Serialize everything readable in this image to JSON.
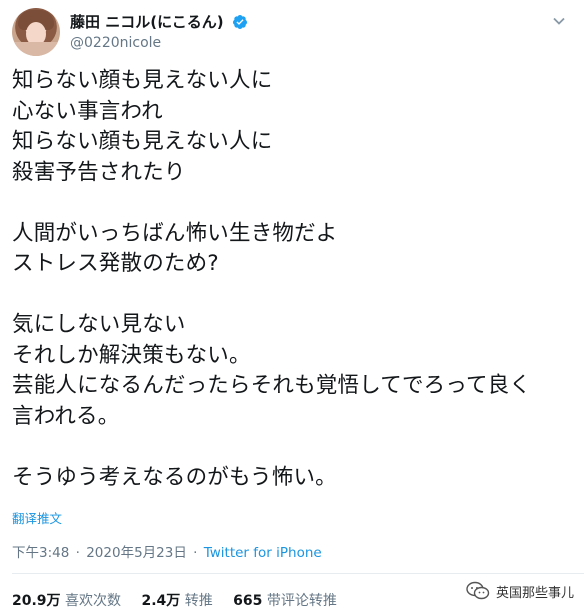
{
  "user": {
    "display_name": "藤田 ニコル(にこるん)",
    "handle": "@0220nicole"
  },
  "tweet": {
    "lines": [
      "知らない顔も見えない人に",
      "心ない事言われ",
      "知らない顔も見えない人に",
      "殺害予告されたり",
      "",
      "人間がいっちばん怖い生き物だよ",
      "ストレス発散のため?",
      "",
      "気にしない見ない",
      "それしか解決策もない。",
      "芸能人になるんだったらそれも覚悟してでろって良く",
      "言われる。",
      "",
      "そうゆう考えなるのがもう怖い。"
    ],
    "translate_label": "翻译推文"
  },
  "meta": {
    "time": "下午3:48",
    "date": "2020年5月23日",
    "separator": "·",
    "source": "Twitter for iPhone"
  },
  "stats": {
    "retweets_num": "20.9万",
    "retweets_label": "喜欢次数",
    "likes_num": "2.4万",
    "likes_label": "转推",
    "quotes_num": "665",
    "quotes_label": "带评论转推"
  },
  "watermark": {
    "text": "英国那些事儿",
    "icon": "wechat-icon"
  },
  "colors": {
    "accent": "#1b95e0",
    "secondary_text": "#657786",
    "verified": "#1da1f2"
  }
}
